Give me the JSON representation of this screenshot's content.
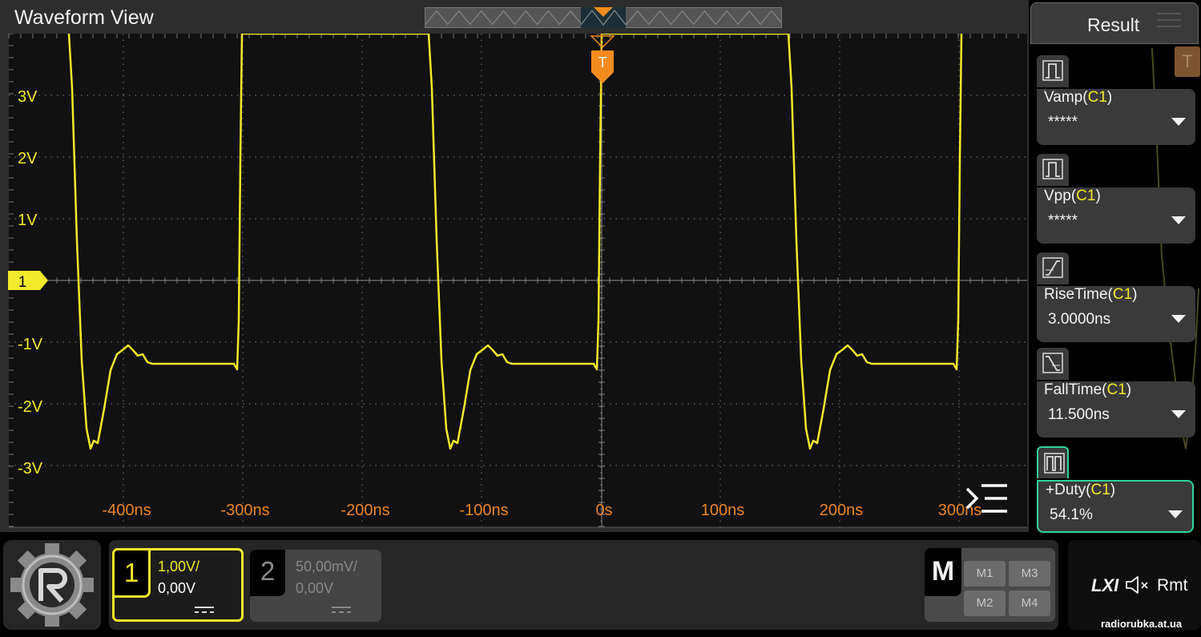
{
  "waveform_view": {
    "title": "Waveform View",
    "trigger_label": "T",
    "channel_marker": "1",
    "y_labels": [
      "3V",
      "2V",
      "1V",
      "-1V",
      "-2V",
      "-3V"
    ],
    "x_labels": [
      "-400ns",
      "-300ns",
      "-200ns",
      "-100ns",
      "0s",
      "100ns",
      "200ns",
      "300ns"
    ]
  },
  "result_panel": {
    "title": "Result",
    "trigger_marker": "T",
    "measurements": [
      {
        "name": "Vamp",
        "channel": "C1",
        "value": "*****",
        "icon": "pulse-amplitude-icon"
      },
      {
        "name": "Vpp",
        "channel": "C1",
        "value": "*****",
        "icon": "pulse-amplitude-icon"
      },
      {
        "name": "RiseTime",
        "channel": "C1",
        "value": "3.0000ns",
        "icon": "rise-edge-icon"
      },
      {
        "name": "FallTime",
        "channel": "C1",
        "value": "11.500ns",
        "icon": "fall-edge-icon"
      },
      {
        "name": "+Duty",
        "channel": "C1",
        "value": "54.1%",
        "icon": "duty-cycle-icon"
      }
    ],
    "selected_index": 4
  },
  "channels": {
    "ch1": {
      "number": "1",
      "scale": "1,00V/",
      "offset": "0,00V",
      "color": "#f2ea2a",
      "active": true
    },
    "ch2": {
      "number": "2",
      "scale": "50,00mV/",
      "offset": "0,00V",
      "color": "#8a8a8a",
      "active": false
    }
  },
  "math": {
    "label": "M",
    "buttons": [
      "M1",
      "M3",
      "M2",
      "M4"
    ]
  },
  "status": {
    "lxi": "LXI",
    "speaker_icon": "speaker-muted-icon",
    "rmt": "Rmt"
  },
  "watermark": "radiorubka.at.ua",
  "colors": {
    "trace": "#f2ea2a",
    "trigger": "#f28c1e",
    "timebase_labels": "#e8852a",
    "accent_green": "#2fd3a0"
  }
}
